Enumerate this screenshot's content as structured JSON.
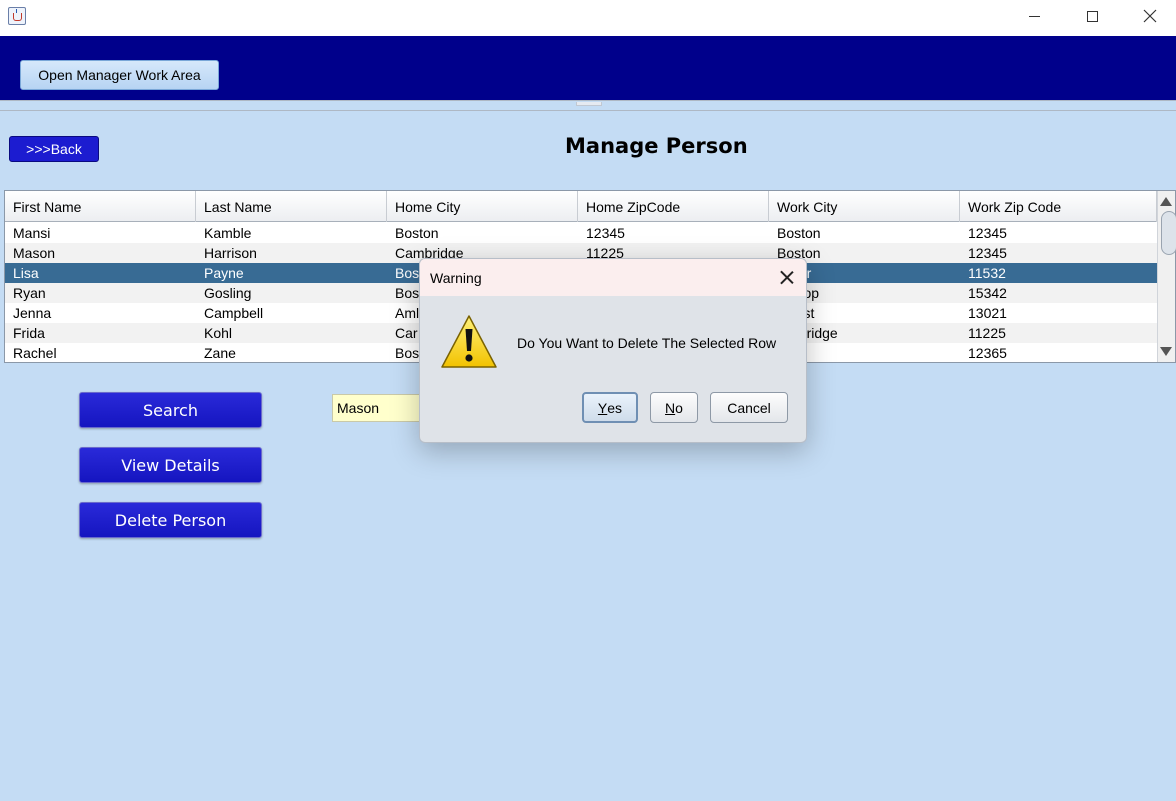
{
  "window": {
    "minimize": "minimize",
    "maximize": "maximize",
    "close": "close"
  },
  "header": {
    "manager_button": "Open Manager Work Area"
  },
  "main": {
    "back_label": ">>>Back",
    "title": "Manage Person",
    "search_value": "Mason"
  },
  "table": {
    "columns": [
      "First Name",
      "Last Name",
      "Home City",
      "Home ZipCode",
      "Work City",
      "Work Zip Code"
    ],
    "rows": [
      [
        "Mansi",
        "Kamble",
        "Boston",
        "12345",
        "Boston",
        "12345"
      ],
      [
        "Mason",
        "Harrison",
        "Cambridge",
        "11225",
        "Boston",
        "12345"
      ],
      [
        "Lisa",
        "Payne",
        "Bos",
        "",
        "her",
        "11532"
      ],
      [
        "Ryan",
        "Gosling",
        "Bos",
        "",
        "hrop",
        "15342"
      ],
      [
        "Jenna",
        "Campbell",
        "Aml",
        "",
        "erst",
        "13021"
      ],
      [
        "Frida",
        "Kohl",
        "Car",
        "",
        "nbridge",
        "11225"
      ],
      [
        "Rachel",
        "Zane",
        "Bos",
        "",
        "on",
        "12365"
      ]
    ],
    "selected_row": 2
  },
  "actions": {
    "search": "Search",
    "view_details": "View Details",
    "delete_person": "Delete Person"
  },
  "dialog": {
    "title": "Warning",
    "message": "Do You Want to Delete The Selected Row",
    "yes_mnemonic": "Y",
    "yes_rest": "es",
    "no_mnemonic": "N",
    "no_rest": "o",
    "cancel": "Cancel"
  },
  "icons": {
    "app": "java-icon",
    "warning": "warning-icon"
  },
  "colors": {
    "header_band": "#00008b",
    "background": "#c4dcf4",
    "primary_button": "#1c1cd0",
    "selected_row": "#386b94",
    "search_field": "#ffffcc"
  }
}
